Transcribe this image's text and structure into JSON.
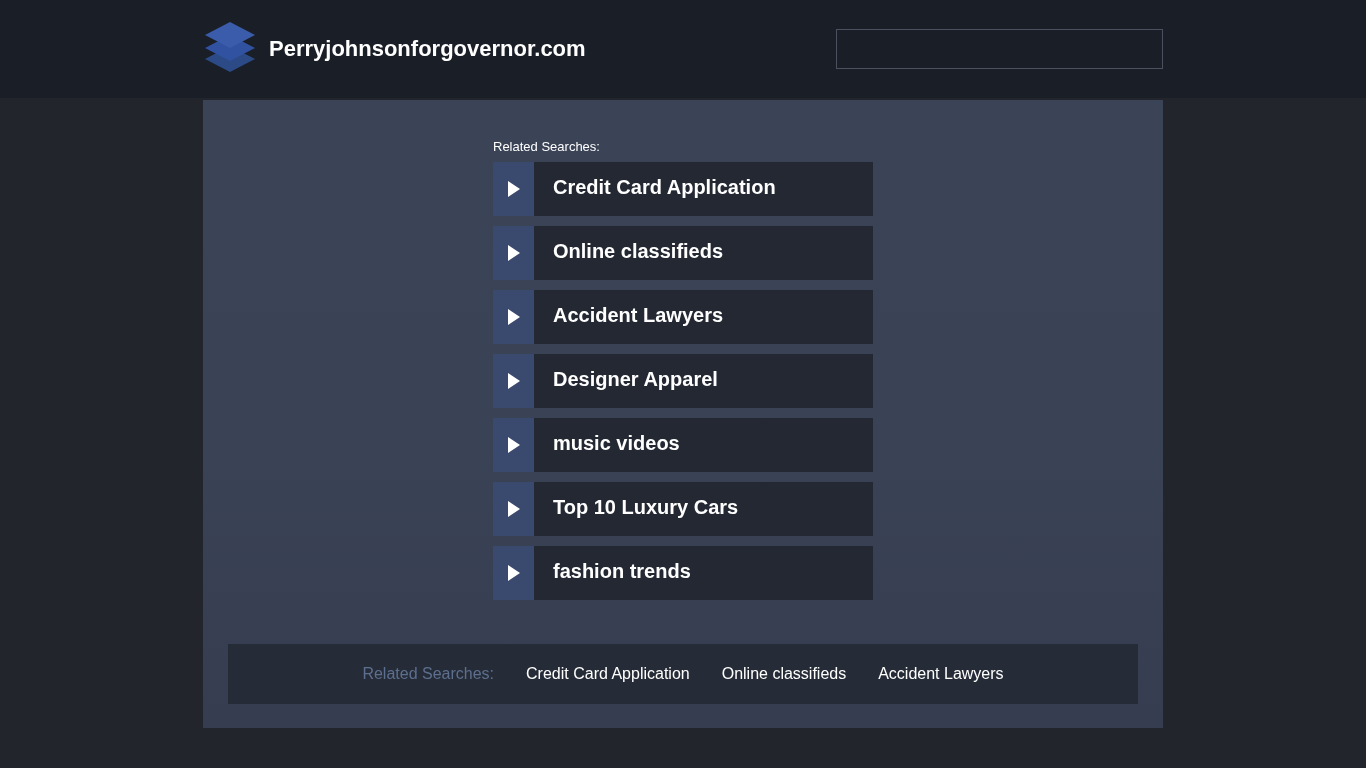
{
  "header": {
    "site_name": "Perryjohnsonforgovernor.com"
  },
  "related": {
    "heading": "Related Searches:",
    "items": [
      {
        "label": "Credit Card Application"
      },
      {
        "label": "Online classifieds"
      },
      {
        "label": "Accident Lawyers"
      },
      {
        "label": "Designer Apparel"
      },
      {
        "label": "music videos"
      },
      {
        "label": "Top 10 Luxury Cars"
      },
      {
        "label": "fashion trends"
      }
    ]
  },
  "footer": {
    "heading": "Related Searches:",
    "links": [
      "Credit Card Application",
      "Online classifieds",
      "Accident Lawyers"
    ]
  }
}
